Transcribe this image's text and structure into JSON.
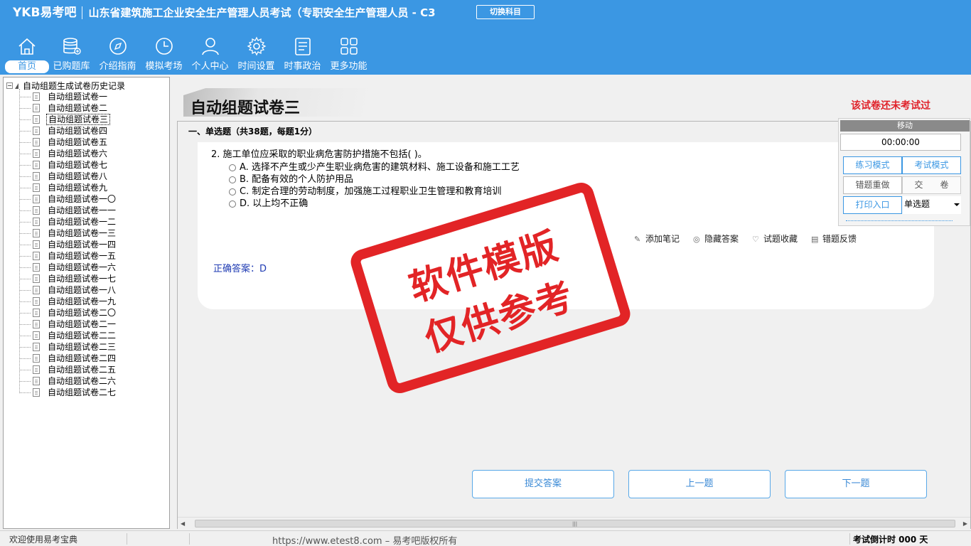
{
  "header": {
    "brand": "YKB易考吧",
    "title": "山东省建筑施工企业安全生产管理人员考试（专职安全生产管理人员 - C3",
    "switch_subject": "切换科目",
    "nav": [
      {
        "label": "首页",
        "icon": "home-icon"
      },
      {
        "label": "已购题库",
        "icon": "database-icon"
      },
      {
        "label": "介绍指南",
        "icon": "compass-icon"
      },
      {
        "label": "模拟考场",
        "icon": "clock-icon"
      },
      {
        "label": "个人中心",
        "icon": "user-icon"
      },
      {
        "label": "时间设置",
        "icon": "gear-icon"
      },
      {
        "label": "时事政治",
        "icon": "news-icon"
      },
      {
        "label": "更多功能",
        "icon": "grid-icon"
      }
    ]
  },
  "tree": {
    "root": "自动组题生成试卷历史记录",
    "items": [
      "自动组题试卷一",
      "自动组题试卷二",
      "自动组题试卷三",
      "自动组题试卷四",
      "自动组题试卷五",
      "自动组题试卷六",
      "自动组题试卷七",
      "自动组题试卷八",
      "自动组题试卷九",
      "自动组题试卷一〇",
      "自动组题试卷一一",
      "自动组题试卷一二",
      "自动组题试卷一三",
      "自动组题试卷一四",
      "自动组题试卷一五",
      "自动组题试卷一六",
      "自动组题试卷一七",
      "自动组题试卷一八",
      "自动组题试卷一九",
      "自动组题试卷二〇",
      "自动组题试卷二一",
      "自动组题试卷二二",
      "自动组题试卷二三",
      "自动组题试卷二四",
      "自动组题试卷二五",
      "自动组题试卷二六",
      "自动组题试卷二七"
    ],
    "selected_index": 2
  },
  "exam": {
    "paper_title": "自动组题试卷三",
    "status_note": "该试卷还未考试过",
    "section": "一、单选题（共38题，每题1分）",
    "question": "2. 施工单位应采取的职业病危害防护措施不包括( )。",
    "options": [
      "A. 选择不产生或少产生职业病危害的建筑材料、施工设备和施工工艺",
      "B. 配备有效的个人防护用品",
      "C. 制定合理的劳动制度，加强施工过程职业卫生管理和教育培训",
      "D. 以上均不正确"
    ],
    "tools": {
      "add_note": "添加笔记",
      "hide_answer": "隐藏答案",
      "favorite": "试题收藏",
      "feedback": "错题反馈"
    },
    "answer": "正确答案：D",
    "buttons": {
      "submit": "提交答案",
      "prev": "上一题",
      "next": "下一题"
    }
  },
  "watermark": {
    "line1": "软件模版",
    "line2": "仅供参考"
  },
  "widget": {
    "move": "移动",
    "timer": "00:00:00",
    "practice_mode": "练习模式",
    "exam_mode": "考试模式",
    "redo_wrong": "错题重做",
    "hand_in": "交　　卷",
    "print": "打印入口",
    "question_type": "单选题"
  },
  "status": {
    "welcome": "欢迎使用易考宝典",
    "copyright": "https://www.etest8.com – 易考吧版权所有",
    "countdown": "考试倒计时 000 天"
  },
  "colors": {
    "header_blue": "#3b97e3",
    "stamp_red": "#e22426",
    "status_red": "#e0222a",
    "answer_blue": "#1f3bb3"
  }
}
